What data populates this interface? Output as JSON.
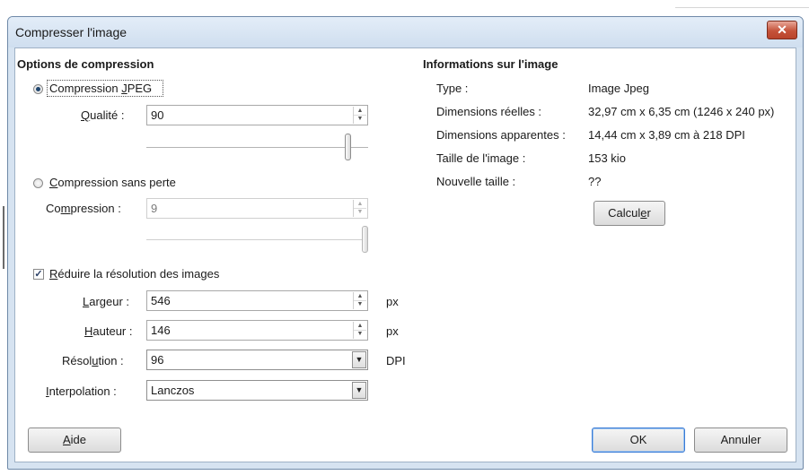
{
  "window": {
    "title": "Compresser l'image",
    "close_glyph": "✕"
  },
  "options": {
    "heading": "Options de compression",
    "jpeg": {
      "label_pre": "Compression ",
      "label_acc": "J",
      "label_post": "PEG",
      "selected": true
    },
    "quality": {
      "label_acc": "Q",
      "label_post": "ualité :",
      "value": "90",
      "level": 0.9
    },
    "lossless": {
      "label_acc": "C",
      "label_post": "ompression sans perte",
      "selected": false
    },
    "compression": {
      "label_pre": "Co",
      "label_acc": "m",
      "label_post": "pression :",
      "value": "9",
      "level": 1.0
    },
    "reduce": {
      "label_acc": "R",
      "label_post": "éduire la résolution des images",
      "checked": true
    },
    "width": {
      "label_acc": "L",
      "label_post": "argeur :",
      "value": "546",
      "unit": "px"
    },
    "height": {
      "label_acc": "H",
      "label_post": "auteur :",
      "value": "146",
      "unit": "px"
    },
    "resolution": {
      "label_pre": "Résol",
      "label_acc": "u",
      "label_post": "tion :",
      "value": "96",
      "unit": "DPI"
    },
    "interpolation": {
      "label_acc": "I",
      "label_post": "nterpolation :",
      "value": "Lanczos"
    }
  },
  "info": {
    "heading": "Informations sur l'image",
    "rows": [
      {
        "label": "Type :",
        "value": "Image Jpeg"
      },
      {
        "label": "Dimensions réelles :",
        "value": "32,97 cm x 6,35 cm (1246 x 240 px)"
      },
      {
        "label": "Dimensions apparentes :",
        "value": "14,44 cm x 3,89 cm à 218 DPI"
      },
      {
        "label": "Taille de l'image :",
        "value": "153 kio"
      },
      {
        "label": "Nouvelle taille :",
        "value": "??"
      }
    ],
    "calc_button": {
      "label_pre": "Calcul",
      "label_acc": "e",
      "label_post": "r"
    }
  },
  "buttons": {
    "help": {
      "label_acc": "A",
      "label_post": "ide"
    },
    "ok": "OK",
    "cancel": "Annuler"
  }
}
